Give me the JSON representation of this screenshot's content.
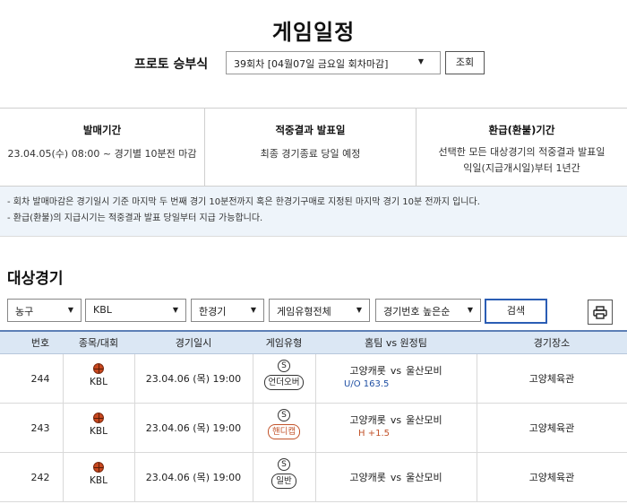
{
  "page_title": "게임일정",
  "round": {
    "label": "프로토 승부식",
    "selected": "39회차 [04월07일 금요일 회차마감]",
    "query_button": "조회"
  },
  "info": [
    {
      "head": "발매기간",
      "lines": [
        "23.04.05(수) 08:00 ~ 경기별 10분전 마감"
      ]
    },
    {
      "head": "적중결과 발표일",
      "lines": [
        "최종 경기종료 당일 예정"
      ]
    },
    {
      "head": "환급(환불)기간",
      "lines": [
        "선택한 모든 대상경기의 적중결과 발표일",
        "익일(지급개시일)부터 1년간"
      ]
    }
  ],
  "notices": [
    "- 회차 발매마감은 경기일시 기준 마지막 두 번째 경기 10분전까지 혹은 한경기구매로 지정된 마지막 경기 10분 전까지 입니다.",
    "- 환급(환불)의 지급시기는 적중결과 발표 당일부터 지급 가능합니다."
  ],
  "section_title": "대상경기",
  "filters": {
    "sport": "농구",
    "league": "KBL",
    "game_count": "한경기",
    "game_type": "게임유형전체",
    "sort": "경기번호 높은순",
    "search_button": "검색"
  },
  "table": {
    "headers": [
      "번호",
      "종목/대회",
      "경기일시",
      "게임유형",
      "홈팀 vs 원정팀",
      "경기장소"
    ],
    "rows": [
      {
        "no": "244",
        "league": "KBL",
        "datetime": "23.04.06 (목) 19:00",
        "type_mark": "S",
        "type": "언더오버",
        "home": "고양캐롯",
        "vs": "vs",
        "away": "울산모비",
        "handicap": "U/O 163.5",
        "venue": "고양체육관"
      },
      {
        "no": "243",
        "league": "KBL",
        "datetime": "23.04.06 (목) 19:00",
        "type_mark": "S",
        "type": "핸디캡",
        "home": "고양캐롯",
        "vs": "vs",
        "away": "울산모비",
        "handicap": "H +1.5",
        "venue": "고양체육관"
      },
      {
        "no": "242",
        "league": "KBL",
        "datetime": "23.04.06 (목) 19:00",
        "type_mark": "S",
        "type": "일반",
        "home": "고양캐롯",
        "vs": "vs",
        "away": "울산모비",
        "handicap": "",
        "venue": "고양체육관"
      }
    ]
  },
  "icons": {
    "dropdown": "caret-down-icon",
    "print": "printer-icon",
    "sport": "basketball-icon"
  },
  "colors": {
    "header_bg": "#dbe7f4",
    "notice_bg": "#eef4fa",
    "search_border": "#2b5db4",
    "uo_text": "#1f4fa3",
    "handicap_text": "#c2532a"
  }
}
